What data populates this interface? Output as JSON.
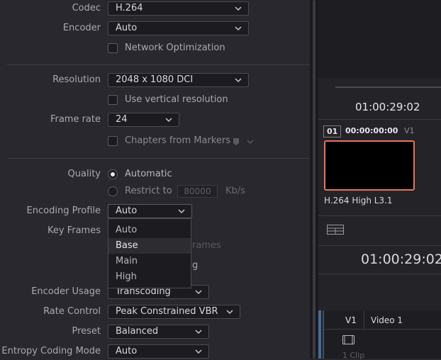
{
  "settings": {
    "codec": {
      "label": "Codec",
      "value": "H.264"
    },
    "encoder": {
      "label": "Encoder",
      "value": "Auto"
    },
    "network_opt": {
      "label": "Network Optimization",
      "checked": false
    },
    "resolution": {
      "label": "Resolution",
      "value": "2048 x 1080 DCI"
    },
    "vertical_res": {
      "label": "Use vertical resolution",
      "checked": false
    },
    "frame_rate": {
      "label": "Frame rate",
      "value": "24"
    },
    "chapters": {
      "label": "Chapters from Markers",
      "checked": false
    },
    "quality": {
      "label": "Quality",
      "automatic": "Automatic",
      "restrict": "Restrict to",
      "restrict_value": "80000",
      "unit": "Kb/s",
      "selected": "Automatic"
    },
    "encoding_profile": {
      "label": "Encoding Profile",
      "value": "Auto",
      "options": [
        "Auto",
        "Base",
        "Main",
        "High"
      ],
      "highlighted": "Base"
    },
    "key_frames": {
      "label": "Key Frames",
      "obscured_1": "rames",
      "obscured_2": "g"
    },
    "encoder_usage": {
      "label": "Encoder Usage",
      "value": "Transcoding"
    },
    "rate_control": {
      "label": "Rate Control",
      "value": "Peak Constrained VBR"
    },
    "preset": {
      "label": "Preset",
      "value": "Balanced"
    },
    "entropy": {
      "label": "Entropy Coding Mode",
      "value": "Auto"
    }
  },
  "right_panel": {
    "timecode_top": "01:00:29:02",
    "clip_index": "01",
    "clip_timecode": "00:00:00:00",
    "clip_track": "V1",
    "clip_codec": "H.264 High L3.1",
    "timecode_large": "01:00:29:02",
    "track_id": "V1",
    "track_name": "Video 1",
    "clip_count": "1 Clip"
  },
  "colors": {
    "accent_border": "#e8735a",
    "panel_bg": "#28282e"
  }
}
